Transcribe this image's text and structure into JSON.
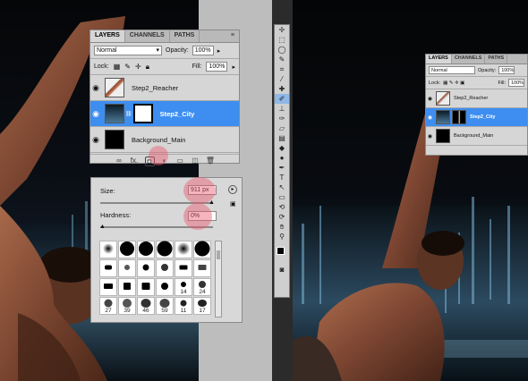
{
  "layers_panel": {
    "tabs": [
      "LAYERS",
      "CHANNELS",
      "PATHS"
    ],
    "blend_mode": "Normal",
    "opacity_label": "Opacity:",
    "opacity_value": "100%",
    "lock_label": "Lock:",
    "fill_label": "Fill:",
    "fill_value": "100%",
    "layers": [
      {
        "name": "Step2_Reacher",
        "selected": false
      },
      {
        "name": "Step2_City",
        "selected": true
      },
      {
        "name": "Background_Main",
        "selected": false
      }
    ],
    "footer_fx": "fx."
  },
  "brush_panel": {
    "size_label": "Size:",
    "size_value": "911 px",
    "hardness_label": "Hardness:",
    "hardness_value": "0%",
    "brush_numbers": [
      "14",
      "24",
      "27",
      "39",
      "46",
      "59",
      "11",
      "17"
    ]
  },
  "small_layers_panel": {
    "tabs": [
      "LAYERS",
      "CHANNELS",
      "PATHS"
    ],
    "blend_mode": "Normal",
    "opacity_label": "Opacity:",
    "opacity_value": "100%",
    "lock_label": "Lock:",
    "fill_label": "Fill:",
    "fill_value": "100%",
    "layers": [
      {
        "name": "Step2_Reacher"
      },
      {
        "name": "Step2_City"
      },
      {
        "name": "Background_Main"
      }
    ]
  },
  "colors": {
    "selection_blue": "#3d8ef0",
    "panel_gray": "#d6d6d6",
    "highlight_pink": "#eb5a6e"
  },
  "tools": [
    "move",
    "marquee",
    "lasso",
    "quick-select",
    "crop",
    "eyedropper",
    "healing",
    "brush",
    "clone-stamp",
    "history-brush",
    "eraser",
    "gradient",
    "blur",
    "dodge",
    "pen",
    "type",
    "path-select",
    "shape",
    "3d-rotate",
    "3d-orbit",
    "hand",
    "zoom"
  ]
}
